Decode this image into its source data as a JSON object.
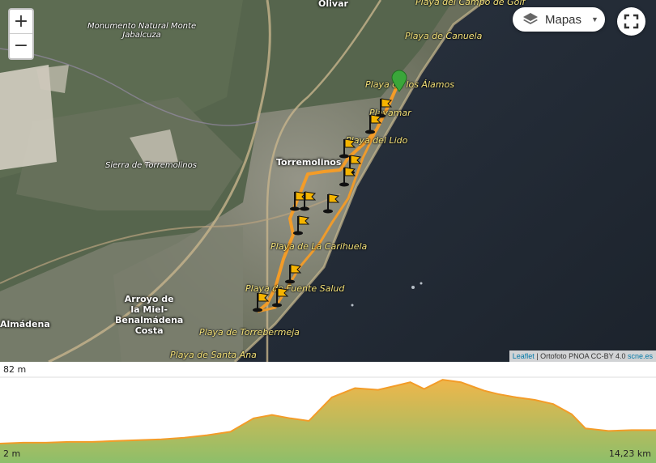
{
  "map": {
    "places": {
      "olivar": "Olivar",
      "playa_campo_golf": "Playa del Campo de Golf",
      "monumento": [
        "Monumento Natural Monte",
        "Jabalcuza"
      ],
      "playa_canuela": "Playa de Canuela",
      "playa_alamos": "Playa de los Álamos",
      "playamar": "Playamar",
      "playa_lido": "Playa del Lido",
      "torremolinos": "Torremolinos",
      "sierra": "Sierra de Torremolinos",
      "carihuela": "Playa de La Carihuela",
      "fuente_salud": "Playa de Fuente Salud",
      "arroyo": [
        "Arroyo de",
        "la Miel-",
        "Benalmádena",
        "Costa"
      ],
      "almadena": "Almádena",
      "torrebermeja": "Playa de Torrebermeja",
      "santa_ana": "Playa de Santa Ana"
    },
    "zoom_in": "+",
    "zoom_out": "−",
    "layers_label": "Mapas",
    "attribution": {
      "link": "Leaflet",
      "rest": " | Ortofoto PNOA CC-BY 4.0 ",
      "credit": "scne.es"
    },
    "icons": {
      "zoom_in": "plus-icon",
      "zoom_out": "minus-icon",
      "layers": "layers-icon",
      "fullscreen": "fullscreen-icon",
      "start": "map-pin-icon",
      "flag": "flag-waypoint-icon"
    },
    "colors": {
      "route": "#f39c28",
      "pin": "#3aa63a",
      "flag": "#f5b400"
    }
  },
  "profile": {
    "max_label": "82 m",
    "min_label": "2 m",
    "distance_label": "14,23 km",
    "chart_data": {
      "type": "area",
      "xlabel": "",
      "ylabel": "",
      "xlim": [
        0,
        14.23
      ],
      "ylim": [
        2,
        82
      ],
      "x": [
        0,
        0.5,
        1.0,
        1.5,
        2.0,
        2.5,
        3.0,
        3.5,
        4.0,
        4.5,
        5.0,
        5.5,
        5.9,
        6.3,
        6.7,
        7.2,
        7.7,
        8.2,
        8.6,
        8.9,
        9.2,
        9.6,
        10.0,
        10.3,
        10.5,
        10.8,
        11.2,
        11.6,
        12.0,
        12.4,
        12.7,
        13.2,
        13.7,
        14.23
      ],
      "y": [
        3,
        4,
        4,
        5,
        5,
        6,
        7,
        8,
        10,
        13,
        17,
        33,
        37,
        33,
        30,
        58,
        69,
        67,
        72,
        76,
        68,
        79,
        76,
        70,
        66,
        62,
        58,
        55,
        50,
        38,
        21,
        18,
        19,
        19
      ],
      "colors": {
        "line": "#f39c28",
        "fill_top": "#efb64b",
        "fill_bottom": "#8dbf6a",
        "grid": "#dddddd"
      }
    }
  }
}
